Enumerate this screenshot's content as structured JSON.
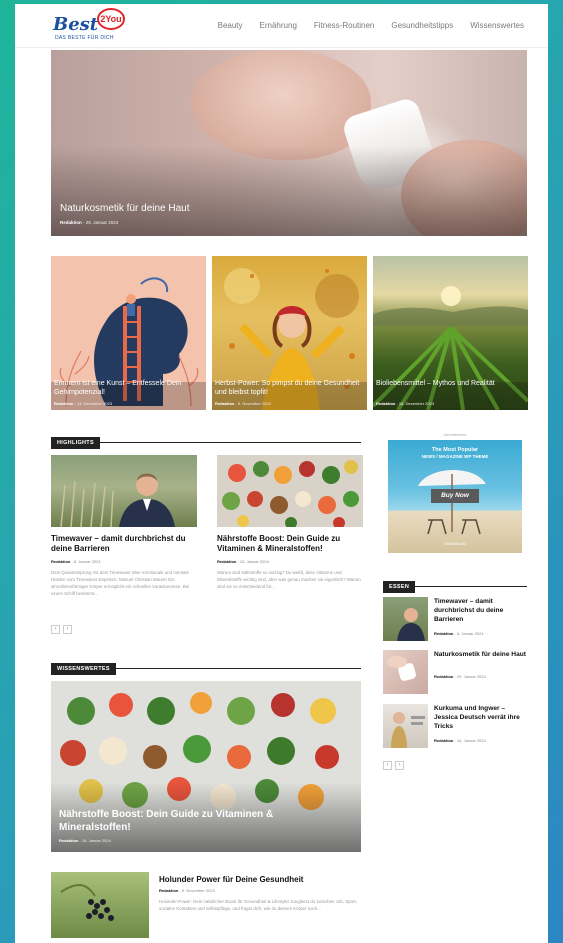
{
  "logo": {
    "name": "Best",
    "badge": "2You",
    "tagline": "DAS BESTE FÜR DICH"
  },
  "nav": [
    "Beauty",
    "Ernährung",
    "Fitness-Routinen",
    "Gesundheitstipps",
    "Wissenswertes"
  ],
  "hero": {
    "title": "Naturkosmetik für deine Haut",
    "author": "Redaktion",
    "date": "29. Januar 2024"
  },
  "tiles": [
    {
      "title": "Erinnern ist eine Kunst – Entfessele Dein Gehirnpotenzial!",
      "author": "Redaktion",
      "date": "13. Dezember 2023"
    },
    {
      "title": "Herbst-Power: So pimpst du deine Gesundheit und bleibst topfit!",
      "author": "Redaktion",
      "date": "5. November 2023"
    },
    {
      "title": "Bioliebensmittel – Mythos und Realität",
      "author": "Redaktion",
      "date": "18. Dezember 2023"
    }
  ],
  "highlights": {
    "label": "HIGHLIGHTS",
    "cards": [
      {
        "title": "Timewaver – damit durchbrichst du deine Barrieren",
        "author": "Redaktion",
        "date": "8. Januar 2024",
        "excerpt": "Dein Quantensprung mit dem Timewaver über emotionale und mentale Hürden vom Timewaver-Experten: Manuel Christian Maurer Ein stromlinienförmiger Körper ermöglicht ein schnelles Vorankommen. Bei einem Schiff bestimmt..."
      },
      {
        "title": "Nährstoffe Boost: Dein Guide zu Vitaminen & Mineralstoffen!",
        "author": "Redaktion",
        "date": "15. Januar 2024",
        "excerpt": "Warum sind Nährstoffe so wichtig? Du weißt, dass Vitamine und Mineralstoffe wichtig sind, aber was genau machen sie eigentlich? Warum sind sie so entscheidend für..."
      }
    ],
    "pager": [
      "‹",
      "›"
    ]
  },
  "ad": {
    "label": "- Advertisement -",
    "line1": "The Most Popular",
    "line2": "NEWS / MAGAZINE WP THEME",
    "button": "Buy Now",
    "size": "300x250 Ad"
  },
  "essen": {
    "label": "ESSEN",
    "items": [
      {
        "title": "Timewaver – damit durchbrichst du deine Barrieren",
        "author": "Redaktion",
        "date": "8. Januar 2024"
      },
      {
        "title": "Naturkosmetik für deine Haut",
        "author": "Redaktion",
        "date": "29. Januar 2024"
      },
      {
        "title": "Kurkuma und Ingwer – Jessica Deutsch verrät ihre Tricks",
        "author": "Redaktion",
        "date": "16. Januar 2024"
      }
    ],
    "pager": [
      "‹",
      "›"
    ]
  },
  "wissenswertes": {
    "label": "WISSENSWERTES",
    "featured": {
      "title": "Nährstoffe Boost: Dein Guide zu Vitaminen & Mineralstoffen!",
      "author": "Redaktion",
      "date": "15. Januar 2024"
    },
    "item": {
      "title": "Holunder Power für Deine Gesundheit",
      "author": "Redaktion",
      "date": "5. November 2023",
      "excerpt": "Holunder-Power: Dein natürlicher Boost für Gesundheit & Lifestyle! Jonglierst du zwischen Job, Sport, sozialen Kontakten und Selbstpflege, und fragst dich, wie du deinem Körper noch..."
    }
  }
}
